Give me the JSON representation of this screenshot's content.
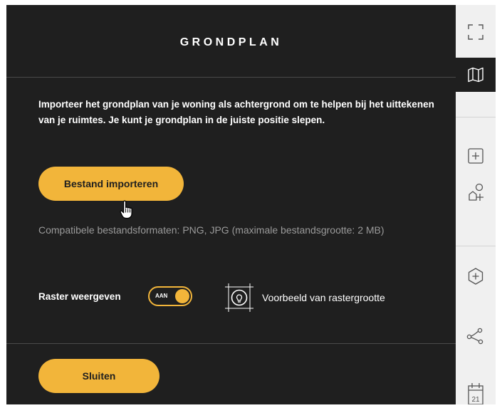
{
  "panel": {
    "title": "GRONDPLAN",
    "description": "Importeer het grondplan van je woning als achtergrond om te helpen bij het uittekenen van je ruimtes. Je kunt je grondplan in de juiste positie slepen.",
    "import_button": "Bestand importeren",
    "formats_text": "Compatibele bestandsformaten: PNG, JPG (maximale bestandsgrootte: 2 MB)",
    "grid_label": "Raster weergeven",
    "grid_toggle_text": "AAN",
    "grid_toggle_on": true,
    "grid_preview_label": "Voorbeeld van rastergrootte",
    "close_button": "Sluiten"
  },
  "sidebar": {
    "items": [
      {
        "icon": "fullscreen-icon",
        "active": false
      },
      {
        "icon": "map-icon",
        "active": true
      },
      {
        "icon": "add-square-icon",
        "active": false
      },
      {
        "icon": "shapes-add-icon",
        "active": false
      },
      {
        "icon": "add-hexagon-icon",
        "active": false
      },
      {
        "icon": "share-nodes-icon",
        "active": false
      },
      {
        "icon": "calendar-icon",
        "active": false,
        "label": "21"
      }
    ]
  },
  "colors": {
    "panel_bg": "#1f1f1f",
    "accent": "#f2b53a",
    "muted_text": "#9a9a9a",
    "sidebar_bg": "#f0f0f0"
  }
}
